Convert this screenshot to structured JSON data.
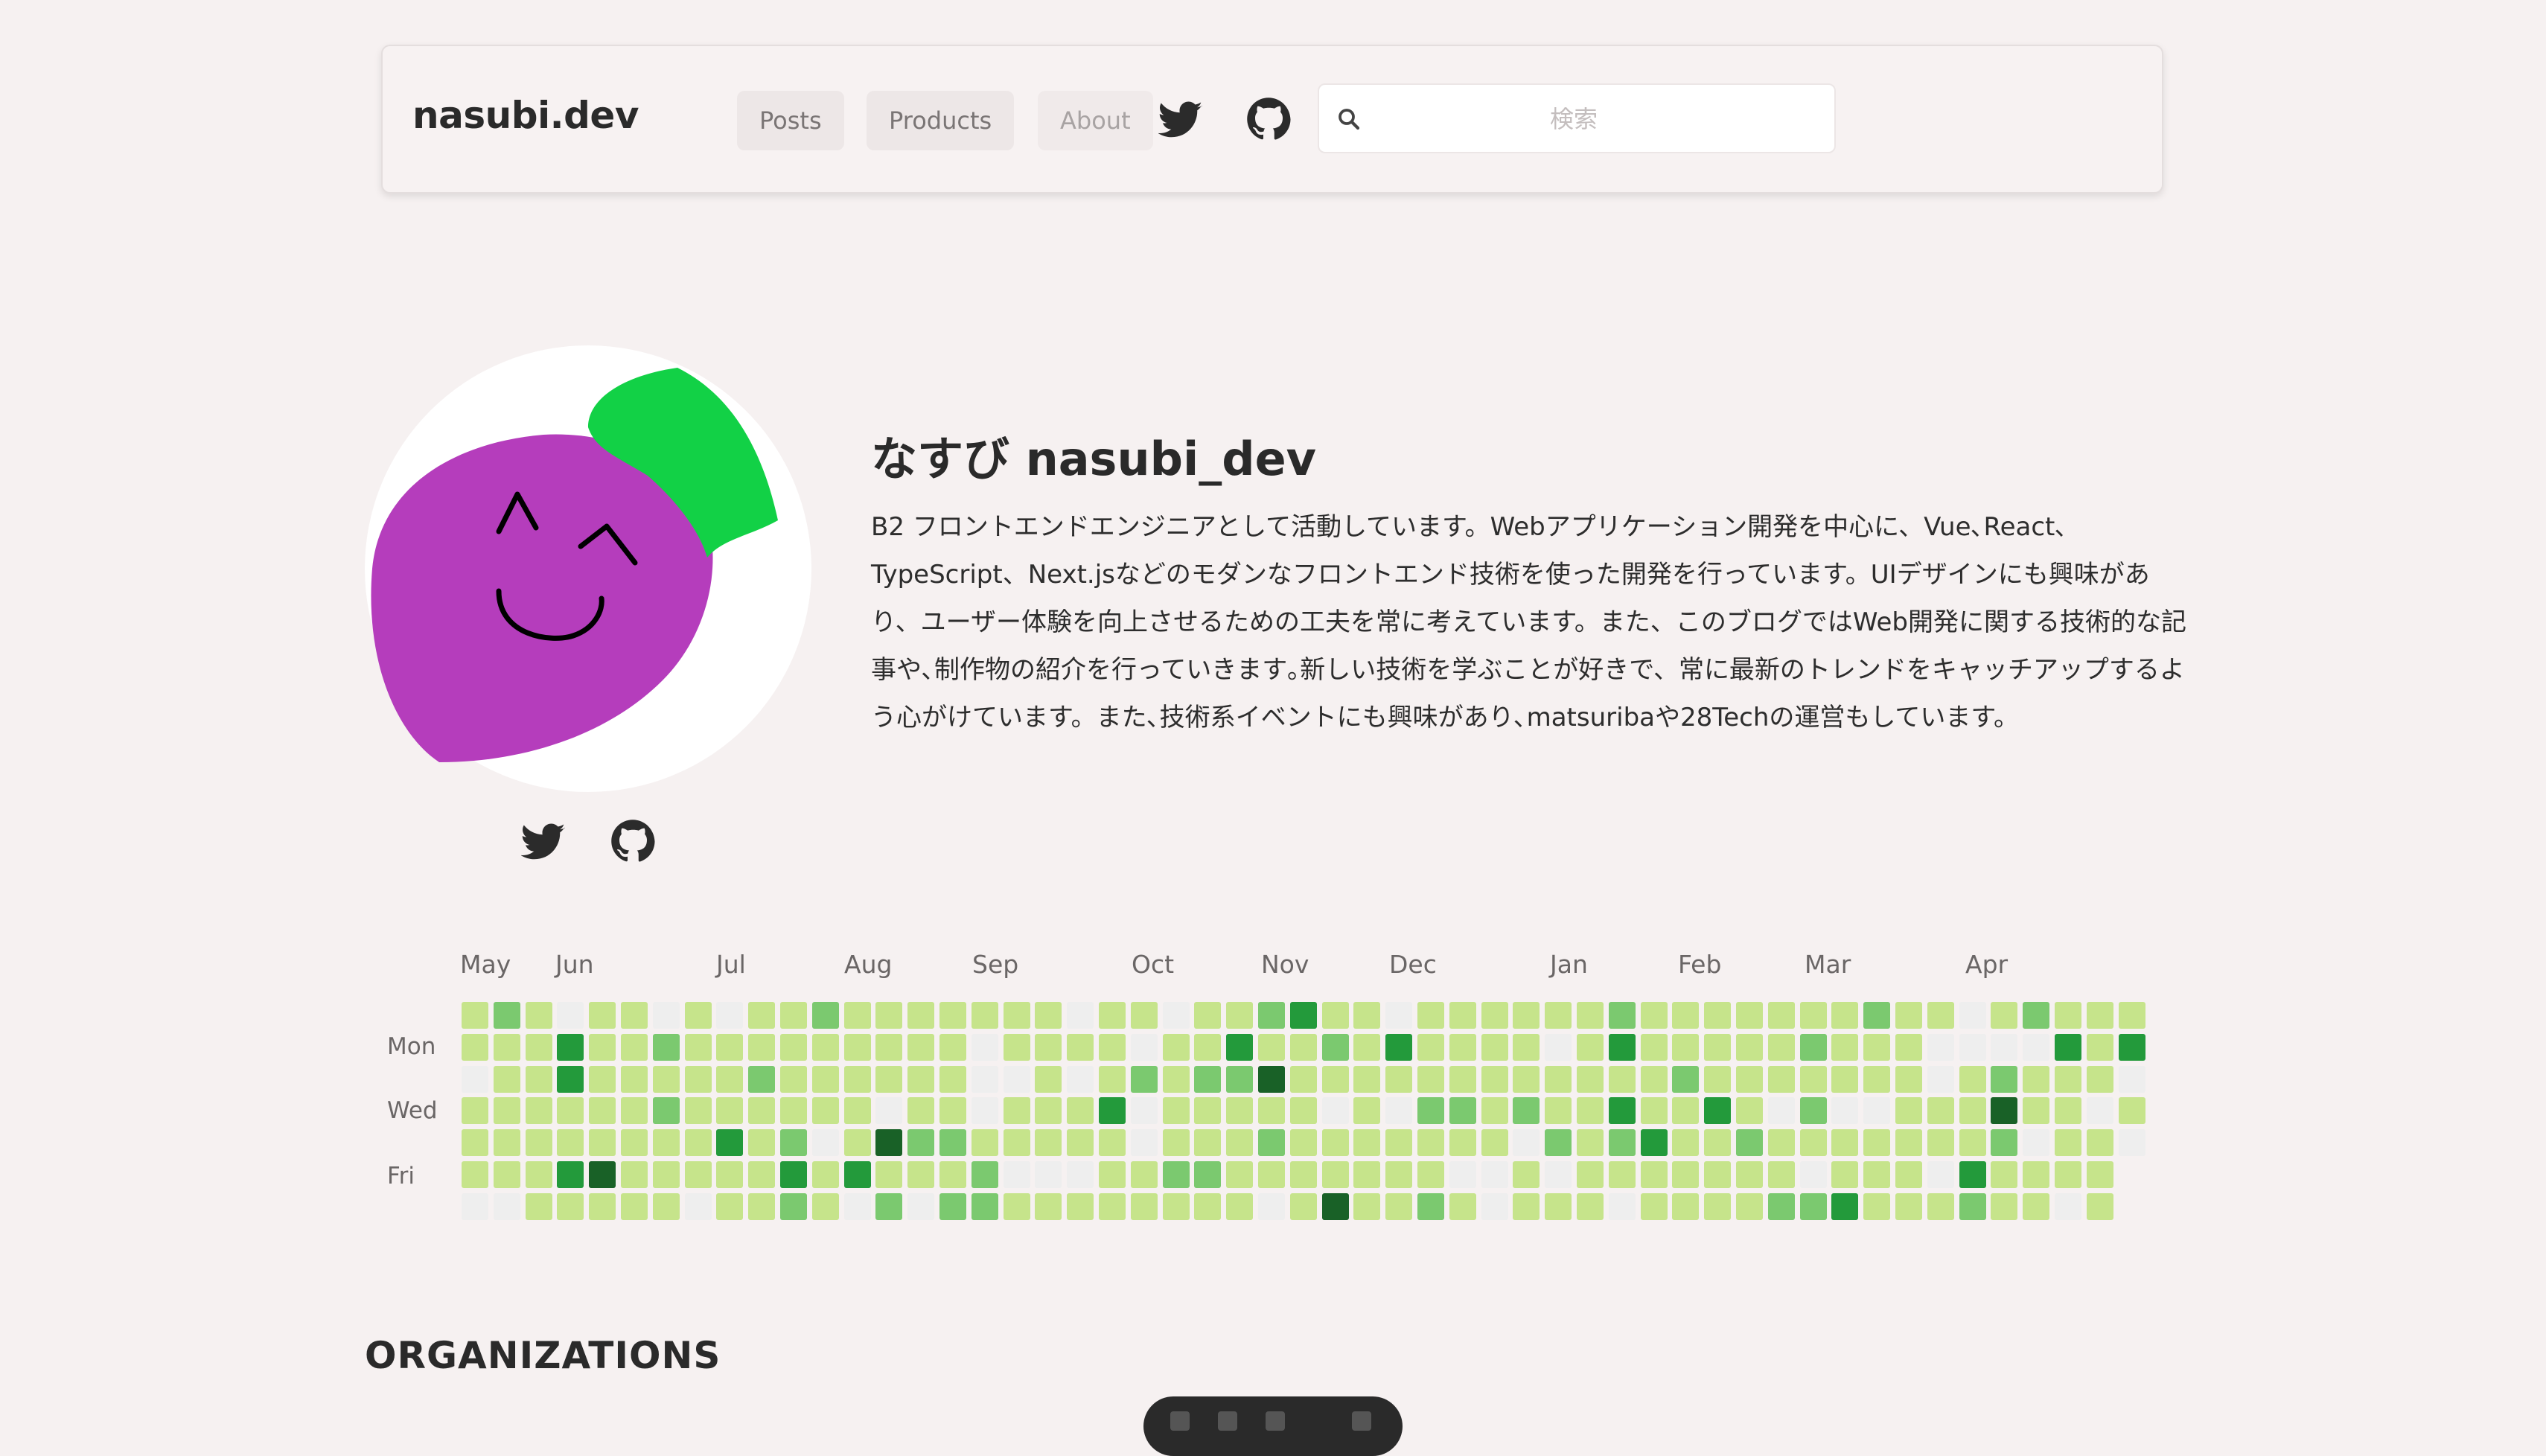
{
  "header": {
    "site_title": "nasubi.dev",
    "nav": [
      {
        "label": "Posts"
      },
      {
        "label": "Products"
      },
      {
        "label": "About"
      }
    ],
    "search": {
      "placeholder": "検索",
      "value": ""
    },
    "icons": [
      "twitter-icon",
      "github-icon"
    ]
  },
  "profile": {
    "name": "なすび nasubi_dev",
    "bio": "B2 フロントエンドエンジニアとして活動しています。Webアプリケーション開発を中心に、Vue､React､TypeScript、Next.jsなどのモダンなフロントエンド技術を使った開発を行っています。UIデザインにも興味があり、ユーザー体験を向上させるための工夫を常に考えています。また、このブログではWeb開発に関する技術的な記事や､制作物の紹介を行っていきます｡新しい技術を学ぶことが好きで、常に最新のトレンドをキャッチアップするよう心がけています。また､技術系イベントにも興味があり､matsuribaや28Techの運営もしています。",
    "links": [
      "twitter-icon",
      "github-icon"
    ]
  },
  "contributions": {
    "months": [
      "May",
      "Jun",
      "Jul",
      "Aug",
      "Sep",
      "Oct",
      "Nov",
      "Dec",
      "Jan",
      "Feb",
      "Mar",
      "Apr"
    ],
    "day_labels": [
      "Mon",
      "Wed",
      "Fri"
    ],
    "colors": [
      "#eeeeee",
      "#c6e48b",
      "#7bc96f",
      "#239a3b",
      "#196127"
    ],
    "weeks": 53
  },
  "organizations": {
    "title": "ORGANIZATIONS"
  }
}
